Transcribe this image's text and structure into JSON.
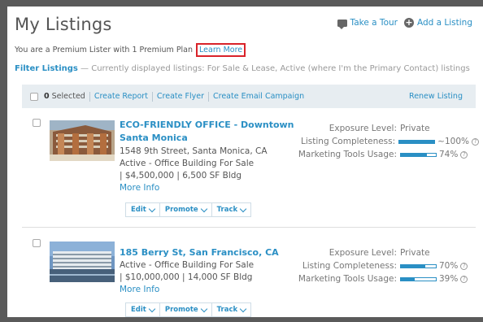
{
  "header": {
    "title": "My Listings",
    "tour_label": "Take a Tour",
    "add_label": "Add a Listing",
    "premium_text": "You are a Premium Lister with 1 Premium Plan",
    "learn_more": "Learn More",
    "filter_label": "Filter Listings",
    "filter_desc": "— Currently displayed listings: For Sale & Lease, Active (where I'm the Primary Contact) listings"
  },
  "toolbar": {
    "selected_count": "0",
    "selected_label": "Selected",
    "create_report": "Create Report",
    "create_flyer": "Create Flyer",
    "create_email": "Create Email Campaign",
    "renew": "Renew Listing"
  },
  "labels": {
    "exposure": "Exposure Level:",
    "completeness": "Listing Completeness:",
    "marketing": "Marketing Tools Usage:",
    "edit": "Edit",
    "promote": "Promote",
    "track": "Track",
    "more_info": "More Info"
  },
  "listings": [
    {
      "title_line1": "ECO-FRIENDLY OFFICE - Downtown",
      "title_line2": "Santa Monica",
      "address": "1548 9th Street, Santa Monica, CA",
      "status": "Active - Office Building For Sale",
      "price": "| $4,500,000 | 6,500 SF Bldg",
      "exposure": "Private",
      "completeness": "~100%",
      "completeness_pct": 100,
      "marketing": "74%",
      "marketing_pct": 74
    },
    {
      "title_line1": "185 Berry St, San Francisco, CA",
      "status": "Active - Office Building For Sale",
      "price": "| $10,000,000 | 14,000 SF Bldg",
      "exposure": "Private",
      "completeness": "70%",
      "completeness_pct": 70,
      "marketing": "39%",
      "marketing_pct": 39
    }
  ],
  "colors": {
    "accent": "#2a8fc4",
    "highlight_border": "#d9232a",
    "toolbar_bg": "#e7edf1"
  },
  "icons": {
    "tour": "chat-bubble-icon",
    "add": "plus-circle-icon",
    "help": "question-circle-icon",
    "chevron": "chevron-down-icon"
  }
}
